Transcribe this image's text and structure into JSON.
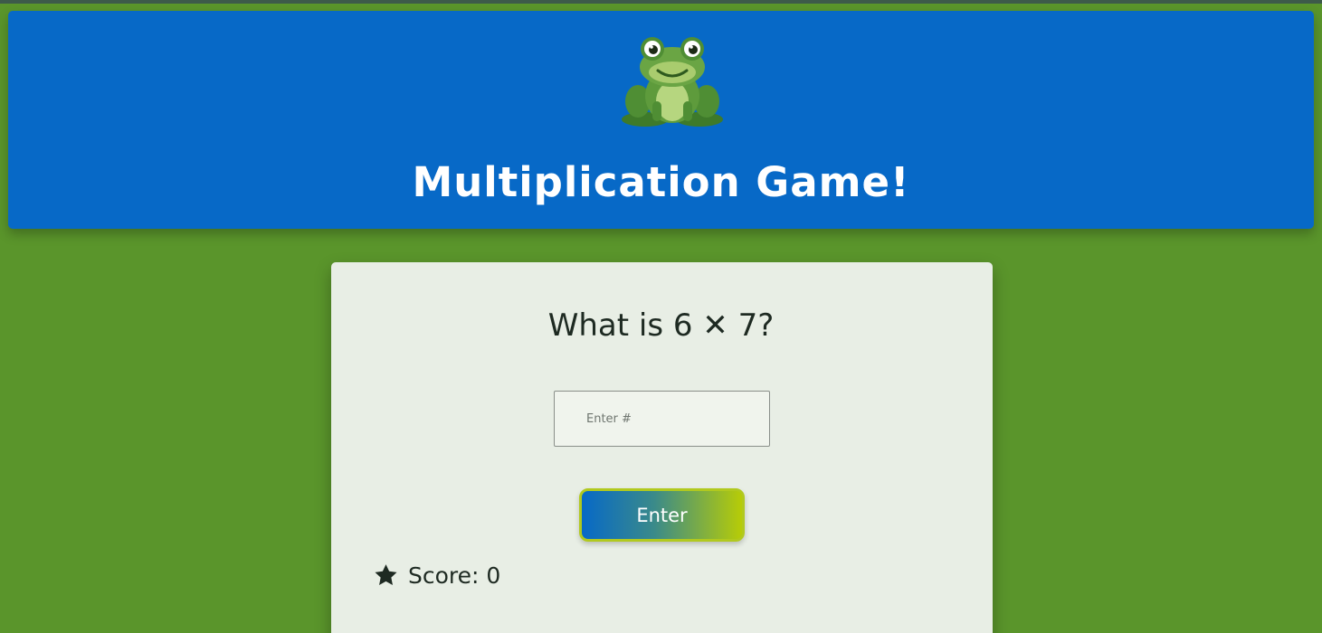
{
  "header": {
    "title": "Multiplication Game!",
    "logo_icon": "frog-icon",
    "background_color": "#0769c7"
  },
  "game": {
    "question": "What is 6 ✕ 7?",
    "answer_input": {
      "value": "",
      "placeholder": "Enter #"
    },
    "enter_button_label": "Enter",
    "score_icon": "star-icon",
    "score_text": "Score: 0"
  },
  "colors": {
    "page_background": "#5a952b",
    "card_background": "#e8eee5",
    "button_gradient_start": "#0769c7",
    "button_gradient_end": "#b7cc07"
  }
}
